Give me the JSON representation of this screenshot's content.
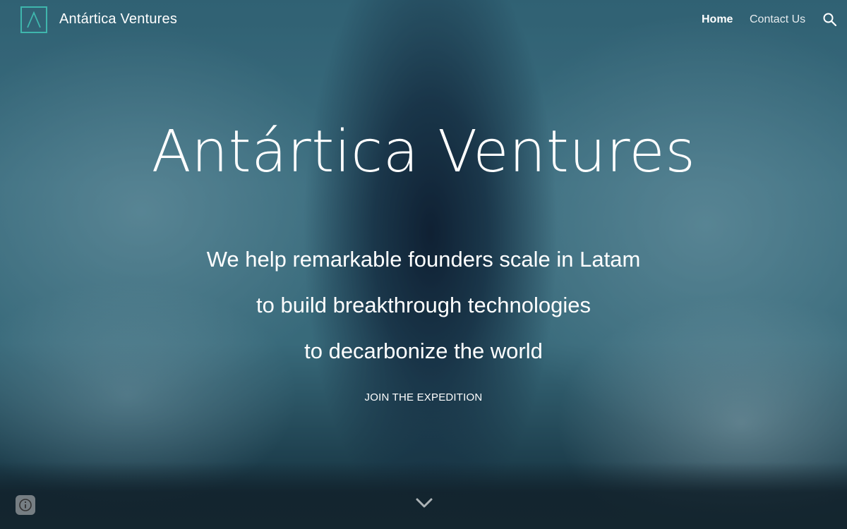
{
  "header": {
    "brand_name": "Antártica Ventures",
    "nav": [
      {
        "label": "Home",
        "active": true
      },
      {
        "label": "Contact Us",
        "active": false
      }
    ],
    "search_icon": "search-icon",
    "logo_icon": "antartica-logo"
  },
  "hero": {
    "title": "Antártica Ventures",
    "tagline_lines": [
      "We help remarkable founders scale in Latam",
      "to build breakthrough technologies",
      "to decarbonize the world"
    ],
    "cta_label": "JOIN THE EXPEDITION",
    "scroll_icon": "chevron-down-icon"
  },
  "footer": {
    "info_icon": "info-icon"
  },
  "colors": {
    "accent": "#3fb6ad",
    "text": "#ffffff"
  }
}
